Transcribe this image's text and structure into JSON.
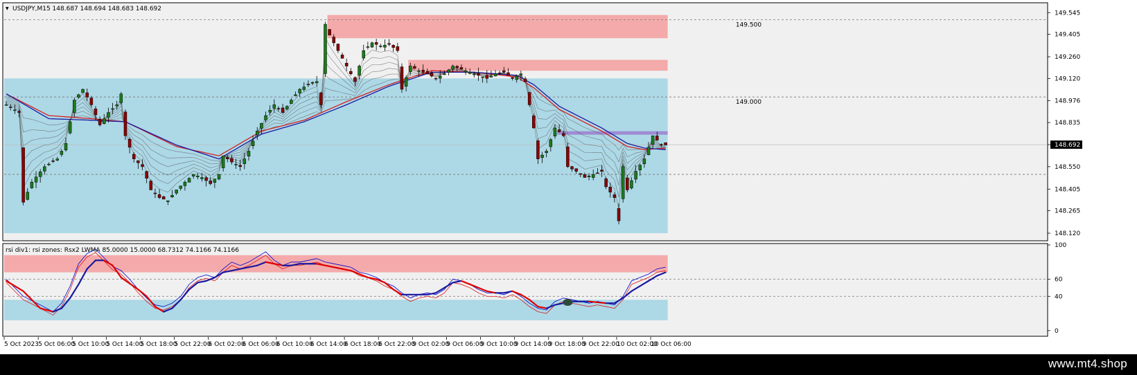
{
  "window": {
    "symbol_header": "USDJPY,M15  148.687 148.694 148.683 148.692",
    "brand": "www.mt4.shop",
    "colors": {
      "background": "#ffffff",
      "pane_bg": "#f0f0f0",
      "demand_zone": "#add8e6",
      "supply_zone": "#f4aaaa",
      "purple_line": "#9b7fcf",
      "ema_red": "#d22020",
      "ema_blue": "#1a1aa0",
      "candle_up": "#1b7d1b",
      "candle_down": "#8b0000",
      "rsi_fast": "#0000cc",
      "rsi_slow": "#dd0000"
    }
  },
  "chart_data": [
    {
      "type": "candlestick",
      "title": "USDJPY,M15  148.687 148.694 148.683 148.692",
      "last_price_label": "148.692",
      "last_price": 148.692,
      "ylim": [
        148.08,
        149.6
      ],
      "y_ticks": [
        "149.545",
        "149.405",
        "149.260",
        "149.120",
        "148.976",
        "148.835",
        "148.692",
        "148.550",
        "148.405",
        "148.265",
        "148.120"
      ],
      "level_labels": [
        {
          "text": "149.500",
          "price": 149.5
        },
        {
          "text": "149.000",
          "price": 149.0
        }
      ],
      "dashed_levels": [
        149.5,
        149.0,
        148.5
      ],
      "zones": [
        {
          "kind": "supply",
          "from_price": 149.38,
          "to_price": 149.53,
          "from_bar": 76,
          "to_bar": 155
        },
        {
          "kind": "supply",
          "from_price": 149.17,
          "to_price": 149.24,
          "from_bar": 95,
          "to_bar": 155
        },
        {
          "kind": "demand",
          "from_price": 148.12,
          "to_price": 149.12,
          "from_bar": 0,
          "to_bar": 155
        },
        {
          "kind": "line",
          "price": 148.77,
          "from_bar": 130,
          "to_bar": 155
        }
      ],
      "x_ticks": [
        "5 Oct 2023",
        "5 Oct 06:00",
        "5 Oct 10:00",
        "5 Oct 14:00",
        "5 Oct 18:00",
        "5 Oct 22:00",
        "6 Oct 02:00",
        "6 Oct 06:00",
        "6 Oct 10:00",
        "6 Oct 14:00",
        "6 Oct 18:00",
        "6 Oct 22:00",
        "9 Oct 02:00",
        "9 Oct 06:00",
        "9 Oct 10:00",
        "9 Oct 14:00",
        "9 Oct 18:00",
        "9 Oct 22:00",
        "10 Oct 02:00",
        "10 Oct 06:00"
      ],
      "close_path": [
        [
          0,
          148.95
        ],
        [
          3,
          148.9
        ],
        [
          4,
          148.32
        ],
        [
          6,
          148.45
        ],
        [
          9,
          148.55
        ],
        [
          12,
          148.6
        ],
        [
          14,
          148.7
        ],
        [
          16,
          148.98
        ],
        [
          18,
          149.05
        ],
        [
          20,
          148.95
        ],
        [
          22,
          148.82
        ],
        [
          24,
          148.9
        ],
        [
          26,
          148.95
        ],
        [
          27,
          149.02
        ],
        [
          28,
          148.75
        ],
        [
          30,
          148.6
        ],
        [
          32,
          148.55
        ],
        [
          34,
          148.4
        ],
        [
          36,
          148.35
        ],
        [
          38,
          148.33
        ],
        [
          40,
          148.4
        ],
        [
          42,
          148.45
        ],
        [
          44,
          148.5
        ],
        [
          46,
          148.48
        ],
        [
          48,
          148.44
        ],
        [
          50,
          148.5
        ],
        [
          51,
          148.62
        ],
        [
          53,
          148.58
        ],
        [
          55,
          148.55
        ],
        [
          57,
          148.65
        ],
        [
          59,
          148.78
        ],
        [
          61,
          148.88
        ],
        [
          63,
          148.95
        ],
        [
          65,
          148.9
        ],
        [
          67,
          148.98
        ],
        [
          69,
          149.05
        ],
        [
          71,
          149.08
        ],
        [
          73,
          149.1
        ],
        [
          74,
          148.95
        ],
        [
          75,
          149.47
        ],
        [
          76,
          149.4
        ],
        [
          78,
          149.3
        ],
        [
          80,
          149.2
        ],
        [
          82,
          149.1
        ],
        [
          84,
          149.3
        ],
        [
          86,
          149.35
        ],
        [
          88,
          149.33
        ],
        [
          90,
          149.34
        ],
        [
          92,
          149.3
        ],
        [
          93,
          149.05
        ],
        [
          95,
          149.2
        ],
        [
          97,
          149.17
        ],
        [
          99,
          149.15
        ],
        [
          101,
          149.12
        ],
        [
          103,
          149.15
        ],
        [
          105,
          149.2
        ],
        [
          107,
          149.18
        ],
        [
          109,
          149.16
        ],
        [
          111,
          149.14
        ],
        [
          113,
          149.12
        ],
        [
          115,
          149.15
        ],
        [
          117,
          149.16
        ],
        [
          119,
          149.12
        ],
        [
          121,
          149.15
        ],
        [
          122,
          149.1
        ],
        [
          123,
          148.95
        ],
        [
          124,
          148.8
        ],
        [
          125,
          148.6
        ],
        [
          127,
          148.65
        ],
        [
          129,
          148.8
        ],
        [
          131,
          148.75
        ],
        [
          132,
          148.55
        ],
        [
          134,
          148.52
        ],
        [
          136,
          148.48
        ],
        [
          138,
          148.5
        ],
        [
          140,
          148.52
        ],
        [
          141,
          148.42
        ],
        [
          143,
          148.35
        ],
        [
          144,
          148.2
        ],
        [
          145,
          148.55
        ],
        [
          146,
          148.4
        ],
        [
          148,
          148.52
        ],
        [
          150,
          148.6
        ],
        [
          152,
          148.75
        ],
        [
          154,
          148.69
        ]
      ],
      "ma_red_path": [
        [
          0,
          149.02
        ],
        [
          10,
          148.88
        ],
        [
          20,
          148.86
        ],
        [
          28,
          148.84
        ],
        [
          40,
          148.68
        ],
        [
          50,
          148.62
        ],
        [
          60,
          148.78
        ],
        [
          70,
          148.85
        ],
        [
          80,
          148.97
        ],
        [
          90,
          149.08
        ],
        [
          100,
          149.17
        ],
        [
          110,
          149.16
        ],
        [
          120,
          149.13
        ],
        [
          124,
          149.06
        ],
        [
          130,
          148.92
        ],
        [
          140,
          148.78
        ],
        [
          146,
          148.68
        ],
        [
          150,
          148.66
        ],
        [
          155,
          148.67
        ]
      ],
      "ma_blue_path": [
        [
          0,
          149.02
        ],
        [
          10,
          148.86
        ],
        [
          20,
          148.85
        ],
        [
          28,
          148.84
        ],
        [
          40,
          148.69
        ],
        [
          50,
          148.6
        ],
        [
          60,
          148.76
        ],
        [
          70,
          148.84
        ],
        [
          80,
          148.95
        ],
        [
          90,
          149.07
        ],
        [
          100,
          149.16
        ],
        [
          110,
          149.16
        ],
        [
          120,
          149.14
        ],
        [
          124,
          149.08
        ],
        [
          130,
          148.94
        ],
        [
          140,
          148.8
        ],
        [
          146,
          148.7
        ],
        [
          150,
          148.67
        ],
        [
          155,
          148.66
        ]
      ]
    },
    {
      "type": "line",
      "title": "rsi div1: rsi zones: Rsx2 LWMA 85.0000 15.0000 68.7312 74.1166 74.1166",
      "ylim": [
        -5,
        100
      ],
      "y_ticks": [
        "100",
        "60",
        "40",
        "0"
      ],
      "y_tick_values": [
        100,
        60,
        40,
        0
      ],
      "dashed_levels": [
        60,
        40
      ],
      "zones": [
        {
          "kind": "supply",
          "from": 68,
          "to": 88
        },
        {
          "kind": "demand",
          "from": 12,
          "to": 36
        }
      ],
      "series": [
        {
          "values": [
            [
              0,
              60
            ],
            [
              4,
              40
            ],
            [
              8,
              30
            ],
            [
              11,
              22
            ],
            [
              13,
              32
            ],
            [
              15,
              52
            ],
            [
              17,
              78
            ],
            [
              19,
              90
            ],
            [
              21,
              95
            ],
            [
              23,
              85
            ],
            [
              25,
              75
            ],
            [
              27,
              70
            ],
            [
              29,
              60
            ],
            [
              31,
              48
            ],
            [
              33,
              38
            ],
            [
              35,
              30
            ],
            [
              37,
              28
            ],
            [
              39,
              32
            ],
            [
              41,
              40
            ],
            [
              43,
              54
            ],
            [
              45,
              62
            ],
            [
              47,
              65
            ],
            [
              49,
              62
            ],
            [
              51,
              72
            ],
            [
              53,
              80
            ],
            [
              55,
              76
            ],
            [
              57,
              80
            ],
            [
              59,
              86
            ],
            [
              61,
              92
            ],
            [
              63,
              82
            ],
            [
              65,
              76
            ],
            [
              67,
              80
            ],
            [
              69,
              80
            ],
            [
              71,
              82
            ],
            [
              73,
              84
            ],
            [
              75,
              80
            ],
            [
              77,
              78
            ],
            [
              79,
              76
            ],
            [
              81,
              74
            ],
            [
              83,
              68
            ],
            [
              85,
              66
            ],
            [
              87,
              62
            ],
            [
              89,
              56
            ],
            [
              91,
              52
            ],
            [
              93,
              44
            ],
            [
              95,
              38
            ],
            [
              97,
              42
            ],
            [
              99,
              44
            ],
            [
              101,
              42
            ],
            [
              103,
              48
            ],
            [
              105,
              60
            ],
            [
              107,
              58
            ],
            [
              109,
              54
            ],
            [
              111,
              48
            ],
            [
              113,
              44
            ],
            [
              115,
              44
            ],
            [
              117,
              42
            ],
            [
              119,
              46
            ],
            [
              121,
              40
            ],
            [
              123,
              32
            ],
            [
              125,
              26
            ],
            [
              127,
              24
            ],
            [
              129,
              34
            ],
            [
              131,
              38
            ],
            [
              133,
              36
            ],
            [
              135,
              34
            ],
            [
              137,
              32
            ],
            [
              139,
              34
            ],
            [
              141,
              32
            ],
            [
              143,
              30
            ],
            [
              145,
              40
            ],
            [
              147,
              58
            ],
            [
              149,
              62
            ],
            [
              151,
              66
            ],
            [
              153,
              72
            ],
            [
              155,
              74
            ]
          ],
          "color": "#0000cc"
        },
        {
          "values": [
            [
              0,
              58
            ],
            [
              4,
              46
            ],
            [
              8,
              26
            ],
            [
              11,
              22
            ],
            [
              13,
              26
            ],
            [
              15,
              38
            ],
            [
              17,
              54
            ],
            [
              19,
              72
            ],
            [
              21,
              82
            ],
            [
              23,
              82
            ],
            [
              25,
              76
            ],
            [
              27,
              62
            ],
            [
              29,
              55
            ],
            [
              31,
              48
            ],
            [
              33,
              40
            ],
            [
              35,
              28
            ],
            [
              37,
              22
            ],
            [
              39,
              26
            ],
            [
              41,
              36
            ],
            [
              43,
              48
            ],
            [
              45,
              56
            ],
            [
              47,
              58
            ],
            [
              49,
              62
            ],
            [
              51,
              68
            ],
            [
              53,
              70
            ],
            [
              55,
              72
            ],
            [
              57,
              74
            ],
            [
              59,
              76
            ],
            [
              61,
              80
            ],
            [
              63,
              78
            ],
            [
              65,
              76
            ],
            [
              67,
              76
            ],
            [
              69,
              78
            ],
            [
              71,
              78
            ],
            [
              73,
              78
            ],
            [
              75,
              76
            ],
            [
              77,
              74
            ],
            [
              79,
              72
            ],
            [
              81,
              70
            ],
            [
              83,
              66
            ],
            [
              85,
              62
            ],
            [
              87,
              60
            ],
            [
              89,
              56
            ],
            [
              91,
              48
            ],
            [
              93,
              42
            ],
            [
              95,
              42
            ],
            [
              97,
              42
            ],
            [
              99,
              42
            ],
            [
              101,
              44
            ],
            [
              103,
              50
            ],
            [
              105,
              56
            ],
            [
              107,
              58
            ],
            [
              109,
              54
            ],
            [
              111,
              50
            ],
            [
              113,
              46
            ],
            [
              115,
              44
            ],
            [
              117,
              44
            ],
            [
              119,
              46
            ],
            [
              121,
              42
            ],
            [
              123,
              36
            ],
            [
              125,
              28
            ],
            [
              127,
              26
            ],
            [
              129,
              30
            ],
            [
              131,
              32
            ],
            [
              133,
              34
            ],
            [
              135,
              34
            ],
            [
              137,
              34
            ],
            [
              139,
              33
            ],
            [
              141,
              32
            ],
            [
              143,
              32
            ],
            [
              145,
              38
            ],
            [
              147,
              46
            ],
            [
              149,
              52
            ],
            [
              151,
              58
            ],
            [
              153,
              64
            ],
            [
              155,
              68
            ]
          ],
          "color": "#1a1aa0"
        }
      ],
      "marker": {
        "x": 132,
        "y": 33
      }
    }
  ]
}
